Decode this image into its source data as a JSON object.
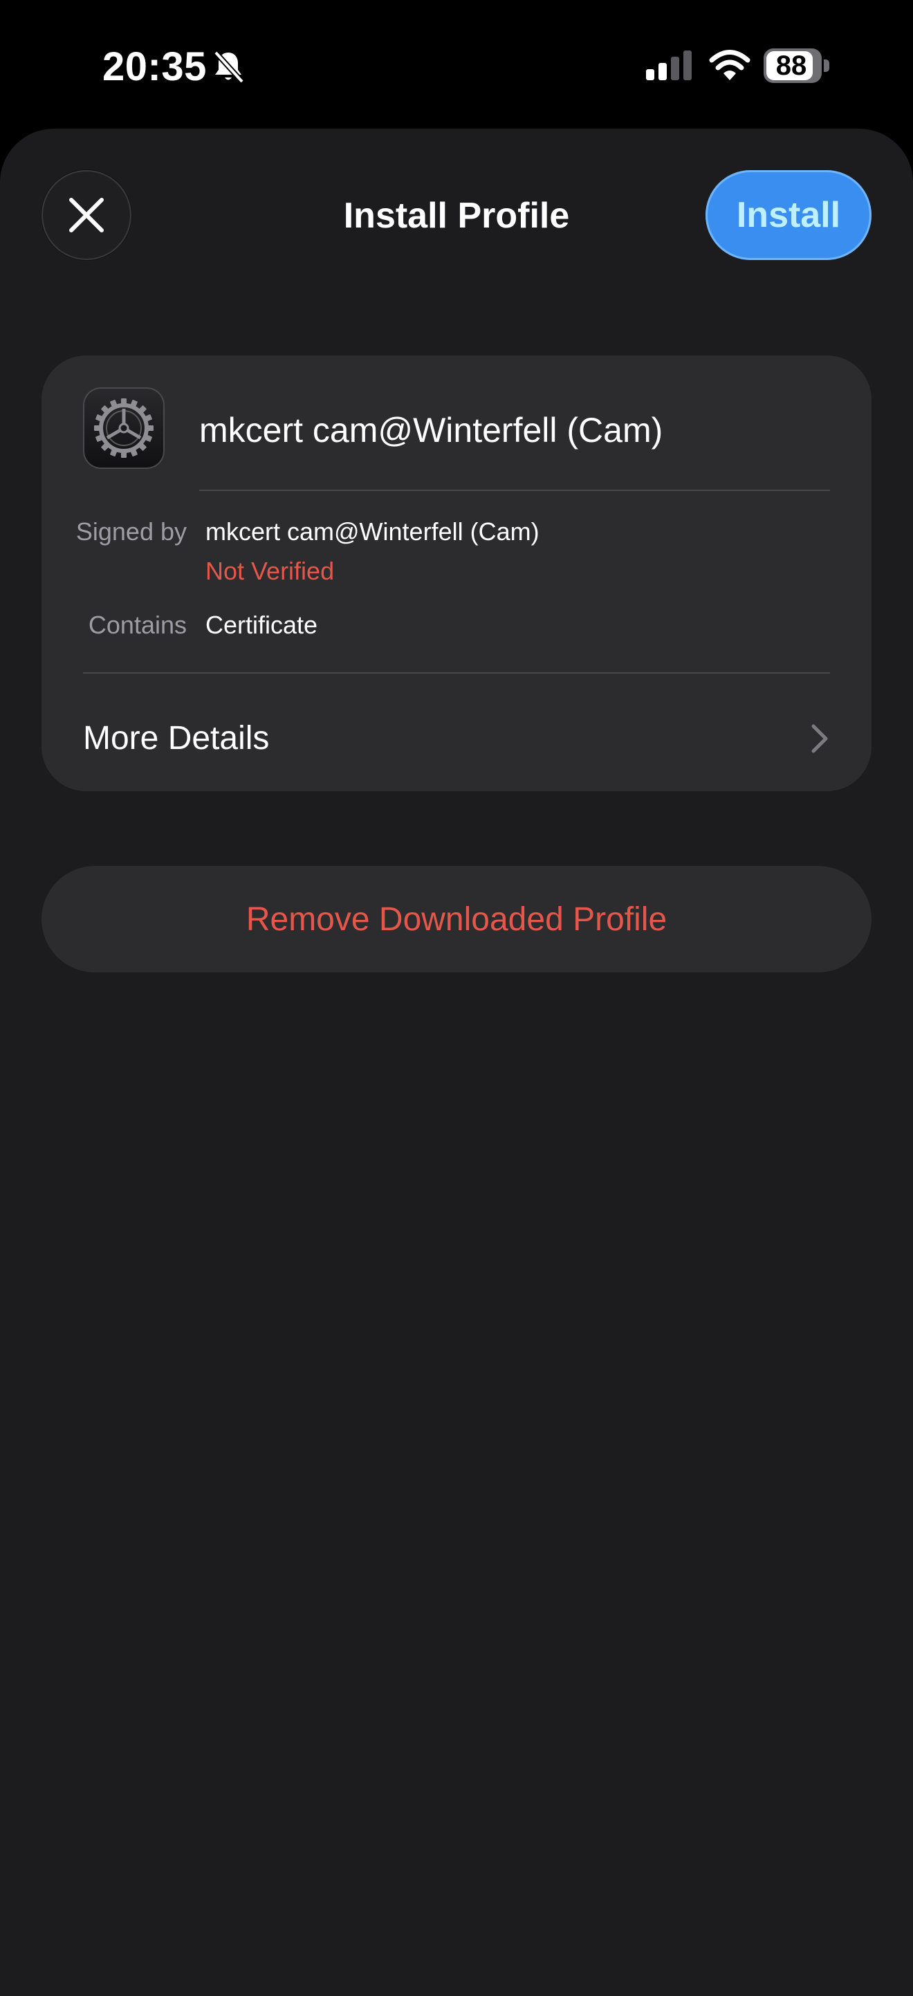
{
  "status_bar": {
    "time": "20:35",
    "battery_level": "88",
    "battery_fraction": 0.88,
    "silent_mode": true,
    "icons": [
      "bell-slash-icon",
      "cellular-signal-icon",
      "wifi-icon",
      "battery-icon"
    ]
  },
  "sheet": {
    "title": "Install Profile",
    "close_icon": "close-icon",
    "install_label": "Install"
  },
  "profile": {
    "icon": "settings-gear-icon",
    "name": "mkcert cam@Winterfell (Cam)",
    "signed_by_label": "Signed by",
    "signed_by_value": "mkcert cam@Winterfell (Cam)",
    "verification_status": "Not Verified",
    "contains_label": "Contains",
    "contains_value": "Certificate",
    "more_details_label": "More Details"
  },
  "actions": {
    "remove_label": "Remove Downloaded Profile"
  },
  "colors": {
    "background": "#000000",
    "sheet": "#1c1c1e",
    "card": "#2c2c2e",
    "accent_blue": "#3a8ef0",
    "destructive_red": "#e5564b",
    "secondary_text": "#9d9da3"
  }
}
